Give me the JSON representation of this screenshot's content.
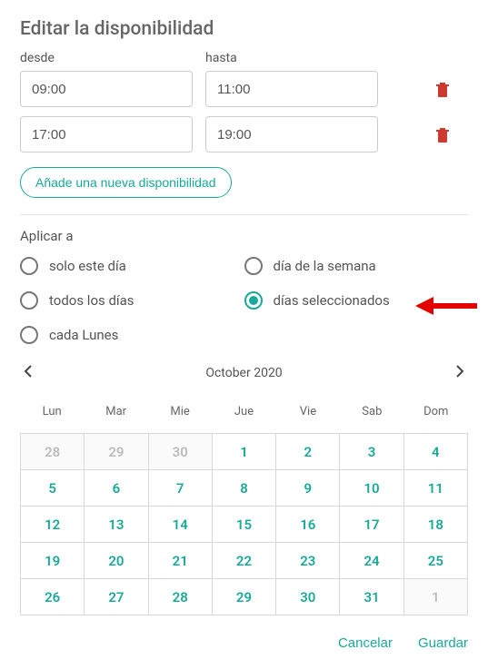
{
  "title": "Editar la disponibilidad",
  "time": {
    "from_label": "desde",
    "to_label": "hasta",
    "rows": [
      {
        "from": "09:00",
        "to": "11:00"
      },
      {
        "from": "17:00",
        "to": "19:00"
      }
    ]
  },
  "add_button": "Añade una nueva disponibilidad",
  "apply_to": {
    "label": "Aplicar a",
    "options": {
      "only_this_day": "solo este día",
      "weekday": "día de la semana",
      "every_day": "todos los días",
      "selected_days": "días seleccionados",
      "every_monday": "cada Lunes"
    },
    "selected": "selected_days"
  },
  "calendar": {
    "title": "October 2020",
    "weekdays": [
      "Lun",
      "Mar",
      "Mie",
      "Jue",
      "Vie",
      "Sab",
      "Dom"
    ],
    "cells": [
      {
        "n": 28,
        "in": false
      },
      {
        "n": 29,
        "in": false
      },
      {
        "n": 30,
        "in": false
      },
      {
        "n": 1,
        "in": true
      },
      {
        "n": 2,
        "in": true
      },
      {
        "n": 3,
        "in": true
      },
      {
        "n": 4,
        "in": true
      },
      {
        "n": 5,
        "in": true
      },
      {
        "n": 6,
        "in": true
      },
      {
        "n": 7,
        "in": true
      },
      {
        "n": 8,
        "in": true
      },
      {
        "n": 9,
        "in": true
      },
      {
        "n": 10,
        "in": true
      },
      {
        "n": 11,
        "in": true
      },
      {
        "n": 12,
        "in": true
      },
      {
        "n": 13,
        "in": true
      },
      {
        "n": 14,
        "in": true
      },
      {
        "n": 15,
        "in": true
      },
      {
        "n": 16,
        "in": true
      },
      {
        "n": 17,
        "in": true
      },
      {
        "n": 18,
        "in": true
      },
      {
        "n": 19,
        "in": true
      },
      {
        "n": 20,
        "in": true
      },
      {
        "n": 21,
        "in": true
      },
      {
        "n": 22,
        "in": true
      },
      {
        "n": 23,
        "in": true
      },
      {
        "n": 24,
        "in": true
      },
      {
        "n": 25,
        "in": true
      },
      {
        "n": 26,
        "in": true
      },
      {
        "n": 27,
        "in": true
      },
      {
        "n": 28,
        "in": true
      },
      {
        "n": 29,
        "in": true
      },
      {
        "n": 30,
        "in": true
      },
      {
        "n": 31,
        "in": true
      },
      {
        "n": 1,
        "in": false
      }
    ]
  },
  "footer": {
    "cancel": "Cancelar",
    "save": "Guardar"
  },
  "colors": {
    "accent": "#18a999",
    "danger": "#cc3a2f"
  }
}
